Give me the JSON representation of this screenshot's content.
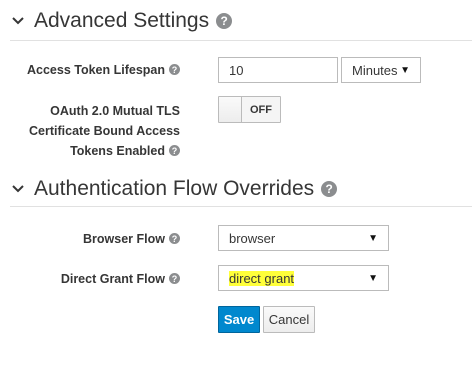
{
  "advanced": {
    "title": "Advanced Settings",
    "help": "?",
    "access_token_label": "Access Token Lifespan",
    "access_token_value": "10",
    "access_token_unit": "Minutes",
    "mtls_label_line1": "OAuth 2.0 Mutual TLS",
    "mtls_label_line2": "Certificate Bound Access",
    "mtls_label_line3": "Tokens Enabled",
    "mtls_toggle": "OFF"
  },
  "auth_flow": {
    "title": "Authentication Flow Overrides",
    "help": "?",
    "browser_flow_label": "Browser Flow",
    "browser_flow_value": "browser",
    "direct_grant_label": "Direct Grant Flow",
    "direct_grant_value_prefix": "d",
    "direct_grant_value_highlight": "irect grant"
  },
  "actions": {
    "save": "Save",
    "cancel": "Cancel"
  },
  "colors": {
    "primary": "#0088ce",
    "highlight": "#ffff3a"
  }
}
